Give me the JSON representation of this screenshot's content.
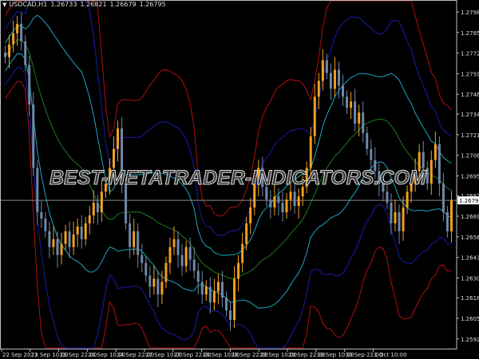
{
  "header": {
    "symbol": "USDCAD,H1",
    "open": "1.26733",
    "high": "1.26821",
    "low": "1.26679",
    "close": "1.26795"
  },
  "watermark": "BEST-METATRADER-INDICATORS.COM",
  "colors": {
    "bull": "#f0a020",
    "bear": "#6f88a8",
    "ma": "#1f7a1f",
    "inner": "#1ba6c0",
    "mid": "#1a1aa8",
    "outer": "#b01010",
    "grid_axis": "#bfbfbf",
    "price_line": "#8a8a8a"
  },
  "chart_data": {
    "type": "candlestick",
    "title": "USDCAD,H1",
    "current_price": "1.26795",
    "ylim": [
      1.2588,
      1.2806
    ],
    "y_ticks": [
      "1.27985",
      "1.27855",
      "1.27725",
      "1.27595",
      "1.27465",
      "1.27340",
      "1.27210",
      "1.27080",
      "1.26950",
      "1.26825",
      "1.26695",
      "1.26565",
      "1.26435",
      "1.26305",
      "1.26180",
      "1.26050",
      "1.25920"
    ],
    "x_ticks": [
      "22 Sep 2021",
      "23 Sep 10:00",
      "23 Sep 22:00",
      "24 Sep 10:00",
      "24 Sep 22:00",
      "27 Sep 10:00",
      "27 Sep 22:00",
      "28 Sep 10:00",
      "28 Sep 22:00",
      "29 Sep 10:00",
      "29 Sep 22:00",
      "30 Sep 10:00",
      "30 Sep 22:00",
      "1 Oct 10:00"
    ],
    "closes": [
      1.277,
      1.2778,
      1.2785,
      1.2791,
      1.278,
      1.2765,
      1.274,
      1.27,
      1.2672,
      1.2668,
      1.266,
      1.265,
      1.2655,
      1.2645,
      1.2652,
      1.266,
      1.265,
      1.2658,
      1.2663,
      1.2655,
      1.2665,
      1.267,
      1.2678,
      1.2672,
      1.2685,
      1.269,
      1.27,
      1.2712,
      1.2725,
      1.269,
      1.2665,
      1.265,
      1.266,
      1.2645,
      1.264,
      1.2632,
      1.2625,
      1.263,
      1.262,
      1.2628,
      1.264,
      1.265,
      1.2655,
      1.2645,
      1.2638,
      1.265,
      1.2642,
      1.2635,
      1.2628,
      1.262,
      1.2625,
      1.2615,
      1.2622,
      1.2628,
      1.2618,
      1.261,
      1.2604,
      1.263,
      1.264,
      1.2652,
      1.2665,
      1.2675,
      1.269,
      1.27,
      1.2688,
      1.268,
      1.2675,
      1.2682,
      1.2678,
      1.2672,
      1.268,
      1.2685,
      1.2676,
      1.2682,
      1.2688,
      1.27,
      1.272,
      1.2745,
      1.2755,
      1.2768,
      1.276,
      1.275,
      1.2762,
      1.2752,
      1.2745,
      1.2738,
      1.2742,
      1.2728,
      1.2735,
      1.2722,
      1.2712,
      1.2705,
      1.2698,
      1.269,
      1.2685,
      1.2678,
      1.2665,
      1.2672,
      1.266,
      1.2675,
      1.2685,
      1.269,
      1.2698,
      1.271,
      1.27,
      1.269,
      1.2705,
      1.2715,
      1.269,
      1.2672,
      1.266,
      1.26795
    ]
  }
}
